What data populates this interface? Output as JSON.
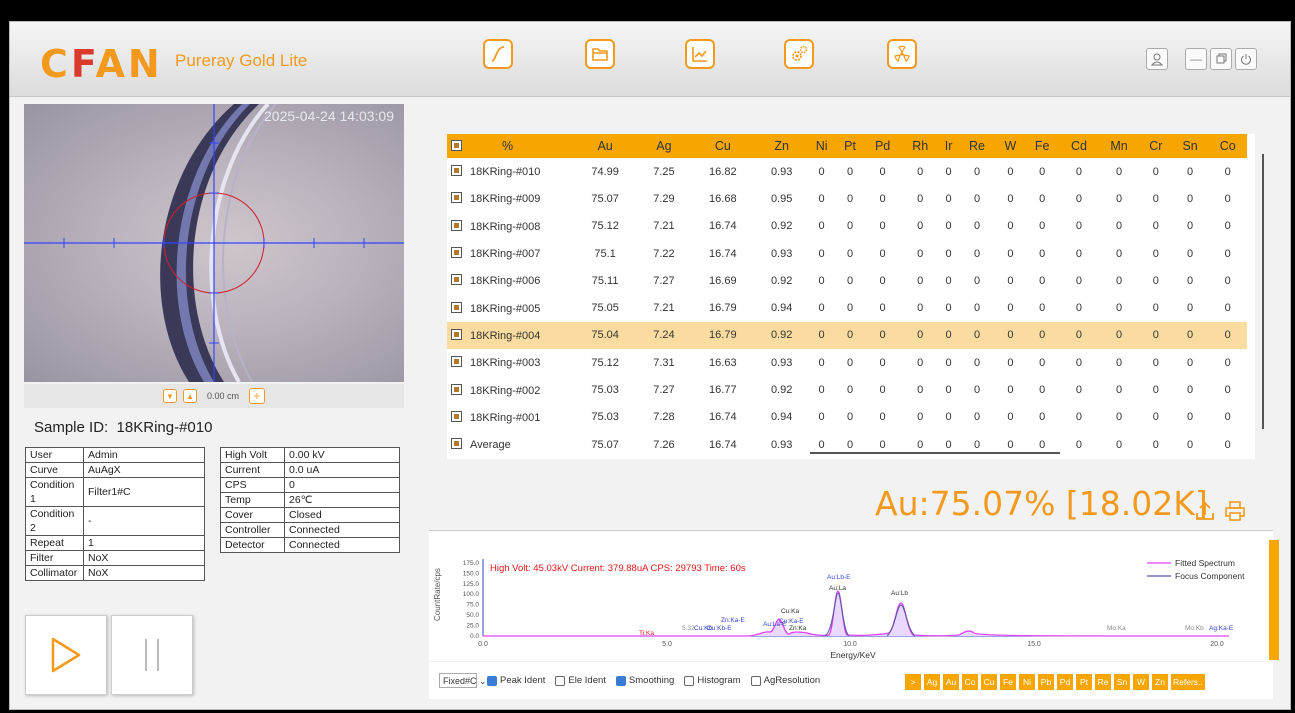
{
  "header": {
    "logo": "CFAN",
    "product": "Pureray Gold Lite",
    "toolbar": [
      "curve-icon",
      "folder-icon",
      "chart-icon",
      "settings-icon",
      "radiation-icon"
    ],
    "window": [
      "user-icon",
      "minimize-icon",
      "restore-icon",
      "power-icon"
    ]
  },
  "camera": {
    "timestamp": "2025-04-24 14:03:09",
    "zoom": "0.00 cm"
  },
  "sample": {
    "label": "Sample ID:",
    "id": "18KRing-#010"
  },
  "info_left": [
    {
      "k": "User",
      "v": "Admin"
    },
    {
      "k": "Curve",
      "v": "AuAgX"
    },
    {
      "k": "Condition 1",
      "v": "Filter1#C"
    },
    {
      "k": "Condition 2",
      "v": "-"
    },
    {
      "k": "Repeat",
      "v": "1"
    },
    {
      "k": "Filter",
      "v": "NoX"
    },
    {
      "k": "Collimator",
      "v": "NoX"
    }
  ],
  "info_right": [
    {
      "k": "High Volt",
      "v": "0.00 kV"
    },
    {
      "k": "Current",
      "v": "0.0 uA"
    },
    {
      "k": "CPS",
      "v": "0"
    },
    {
      "k": "Temp",
      "v": "26℃"
    },
    {
      "k": "Cover",
      "v": "Closed"
    },
    {
      "k": "Controller",
      "v": "Connected"
    },
    {
      "k": "Detector",
      "v": "Connected"
    }
  ],
  "results": {
    "headers": [
      "%",
      "Au",
      "Ag",
      "Cu",
      "Zn",
      "Ni",
      "Pt",
      "Pd",
      "Rh",
      "Ir",
      "Re",
      "W",
      "Fe",
      "Cd",
      "Mn",
      "Cr",
      "Sn",
      "Co"
    ],
    "rows": [
      [
        "18KRing-#010",
        "74.99",
        "7.25",
        "16.82",
        "0.93",
        "0",
        "0",
        "0",
        "0",
        "0",
        "0",
        "0",
        "0",
        "0",
        "0",
        "0",
        "0",
        "0"
      ],
      [
        "18KRing-#009",
        "75.07",
        "7.29",
        "16.68",
        "0.95",
        "0",
        "0",
        "0",
        "0",
        "0",
        "0",
        "0",
        "0",
        "0",
        "0",
        "0",
        "0",
        "0"
      ],
      [
        "18KRing-#008",
        "75.12",
        "7.21",
        "16.74",
        "0.92",
        "0",
        "0",
        "0",
        "0",
        "0",
        "0",
        "0",
        "0",
        "0",
        "0",
        "0",
        "0",
        "0"
      ],
      [
        "18KRing-#007",
        "75.1",
        "7.22",
        "16.74",
        "0.93",
        "0",
        "0",
        "0",
        "0",
        "0",
        "0",
        "0",
        "0",
        "0",
        "0",
        "0",
        "0",
        "0"
      ],
      [
        "18KRing-#006",
        "75.11",
        "7.27",
        "16.69",
        "0.92",
        "0",
        "0",
        "0",
        "0",
        "0",
        "0",
        "0",
        "0",
        "0",
        "0",
        "0",
        "0",
        "0"
      ],
      [
        "18KRing-#005",
        "75.05",
        "7.21",
        "16.79",
        "0.94",
        "0",
        "0",
        "0",
        "0",
        "0",
        "0",
        "0",
        "0",
        "0",
        "0",
        "0",
        "0",
        "0"
      ],
      [
        "18KRing-#004",
        "75.04",
        "7.24",
        "16.79",
        "0.92",
        "0",
        "0",
        "0",
        "0",
        "0",
        "0",
        "0",
        "0",
        "0",
        "0",
        "0",
        "0",
        "0"
      ],
      [
        "18KRing-#003",
        "75.12",
        "7.31",
        "16.63",
        "0.93",
        "0",
        "0",
        "0",
        "0",
        "0",
        "0",
        "0",
        "0",
        "0",
        "0",
        "0",
        "0",
        "0"
      ],
      [
        "18KRing-#002",
        "75.03",
        "7.27",
        "16.77",
        "0.92",
        "0",
        "0",
        "0",
        "0",
        "0",
        "0",
        "0",
        "0",
        "0",
        "0",
        "0",
        "0",
        "0"
      ],
      [
        "18KRing-#001",
        "75.03",
        "7.28",
        "16.74",
        "0.94",
        "0",
        "0",
        "0",
        "0",
        "0",
        "0",
        "0",
        "0",
        "0",
        "0",
        "0",
        "0",
        "0"
      ],
      [
        "Average",
        "75.07",
        "7.26",
        "16.74",
        "0.93",
        "0",
        "0",
        "0",
        "0",
        "0",
        "0",
        "0",
        "0",
        "0",
        "0",
        "0",
        "0",
        "0"
      ]
    ],
    "selected_row": 6
  },
  "summary": {
    "text": "Au:75.07%  [18.02K]"
  },
  "spectrum": {
    "status": "High Volt: 45.03kV  Current: 379.88uA  CPS: 29793  Time: 60s",
    "ylabel": "CountRate/cps",
    "xlabel": "Energy/KeV",
    "yticks": [
      "175.0",
      "150.0",
      "125.0",
      "100.0",
      "75.0",
      "50.0",
      "25.0",
      "0.0"
    ],
    "xticks": [
      "0.0",
      "5.0",
      "10.0",
      "15.0",
      "20.0"
    ],
    "legend": [
      "Fitted Spectrum",
      "Focus Component"
    ],
    "peak_labels": [
      "Ti:Ka",
      "5.32",
      "Cu:Kb",
      "Zn:Ka-E",
      "Au:La-E",
      "Cu:Ka",
      "Zn:Ka",
      "Au:Lb-E",
      "Au:La",
      "Au:Lb",
      "Mo:Ka",
      "Mo:Kb",
      "Ag:Ka-E",
      "Cu:Kb-E",
      "Cu:Ka-E"
    ]
  },
  "controls": {
    "select_value": "Fixed#C",
    "options": [
      {
        "label": "Peak Ident",
        "checked": true
      },
      {
        "label": "Ele Ident",
        "checked": false
      },
      {
        "label": "Smoothing",
        "checked": true
      },
      {
        "label": "Histogram",
        "checked": false
      },
      {
        "label": "AgResolution",
        "checked": false
      }
    ],
    "element_buttons": [
      ">",
      "Ag",
      "Au",
      "Co",
      "Cu",
      "Fe",
      "Ni",
      "Pb",
      "Pd",
      "Pt",
      "Re",
      "Sn",
      "W",
      "Zn",
      "Refers.."
    ]
  },
  "colors": {
    "accent": "#f39a1e",
    "header_orange": "#f7a600",
    "fitted": "#e040fb",
    "focus": "#5a5a9e"
  }
}
